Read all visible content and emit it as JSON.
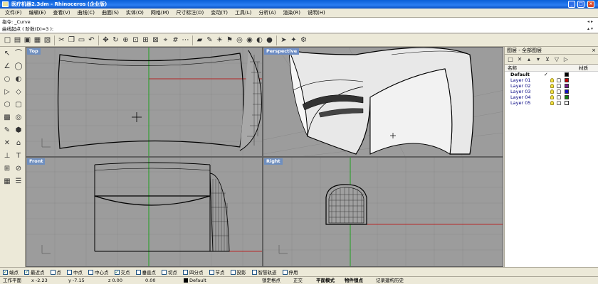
{
  "window": {
    "title": "医疗机器2.3dm - Rhinoceros (企业版)",
    "btn_min": "_",
    "btn_max": "□",
    "btn_close": "×"
  },
  "menu": [
    "文件(F)",
    "编辑(E)",
    "查看(V)",
    "曲线(C)",
    "曲面(S)",
    "实体(O)",
    "网格(M)",
    "尺寸标注(D)",
    "变动(T)",
    "工具(L)",
    "分析(A)",
    "渲染(R)",
    "说明(H)"
  ],
  "command": {
    "line1": "指令: _Curve",
    "line2": "曲线起点 ( 阶数(D)=3 ):",
    "scroll_up": "◂ ▸",
    "scroll_down": "▴ ▾"
  },
  "toolbar_icons": [
    "new-file-icon",
    "open-icon",
    "save-icon",
    "print-icon",
    "import-icon",
    "cut-icon",
    "copy-icon",
    "paste-icon",
    "undo-icon",
    "pan-hand-icon",
    "rotate-view-icon",
    "zoom-icon",
    "zoom-window-icon",
    "zoom-extents-icon",
    "zoom-selected-icon",
    "set-cplane-icon",
    "grid-icon",
    "select-point-icon",
    "layer-icon",
    "properties-icon",
    "lightbulb-icon",
    "bookmark-icon",
    "render-icon",
    "color-icon",
    "material-icon",
    "sphere-render-icon",
    "arrow-icon",
    "puzzle-icon",
    "options-icon"
  ],
  "toolbar_glyphs": [
    "□",
    "▤",
    "▣",
    "▦",
    "▧",
    "✂",
    "❐",
    "▭",
    "↶",
    "✥",
    "↻",
    "⊕",
    "⊡",
    "⊞",
    "⊠",
    "⌖",
    "#",
    "⋯",
    "▰",
    "✎",
    "☀",
    "⚑",
    "◎",
    "◉",
    "◐",
    "●",
    "➤",
    "✦",
    "⚙"
  ],
  "left_tools": [
    "↖",
    "⌒",
    "∠",
    "◯",
    "○",
    "◐",
    "▷",
    "◇",
    "⬡",
    "▢",
    "▩",
    "◎",
    "✎",
    "⬢",
    "✕",
    "⌂",
    "⊥",
    "T",
    "⊞",
    "⊘",
    "▦",
    "☰"
  ],
  "viewports": {
    "top": "Top",
    "perspective": "Perspective",
    "front": "Front",
    "right": "Right"
  },
  "layers_panel": {
    "title": "图层 - 全部图层",
    "close": "×",
    "tools": [
      "□",
      "✕",
      "▴",
      "▾",
      "⊻",
      "▽",
      "▷"
    ],
    "col_name": "名称",
    "col_material": "材质",
    "check": "✓",
    "rows": [
      {
        "name": "Default",
        "color": "#000000",
        "current": true
      },
      {
        "name": "Layer 01",
        "color": "#c00000",
        "current": false
      },
      {
        "name": "Layer 02",
        "color": "#7a1f8a",
        "current": false
      },
      {
        "name": "Layer 03",
        "color": "#1010c0",
        "current": false
      },
      {
        "name": "Layer 04",
        "color": "#108010",
        "current": false
      },
      {
        "name": "Layer 05",
        "color": "#ffffff",
        "current": false
      }
    ]
  },
  "osnaps": [
    {
      "label": "端点",
      "checked": true
    },
    {
      "label": "最近点",
      "checked": true
    },
    {
      "label": "点",
      "checked": false
    },
    {
      "label": "中点",
      "checked": false
    },
    {
      "label": "中心点",
      "checked": false
    },
    {
      "label": "交点",
      "checked": true
    },
    {
      "label": "垂直点",
      "checked": false
    },
    {
      "label": "切点",
      "checked": false
    },
    {
      "label": "四分点",
      "checked": false
    },
    {
      "label": "节点",
      "checked": false
    },
    {
      "label": "投影",
      "checked": false
    },
    {
      "label": "智慧轨迹",
      "checked": false
    },
    {
      "label": "停用",
      "checked": false
    }
  ],
  "status": {
    "cplane": "工作平面",
    "x": "x -2.23",
    "y": "y -7.15",
    "z": "z 0.00",
    "dist": "0.00",
    "layer": "Default",
    "grid_snap": "锁定格点",
    "ortho": "正交",
    "planar": "平面模式",
    "osnap": "物件锁点",
    "history": "记录建构历史"
  },
  "colors": {
    "viewport_bg": "#9c9c9c",
    "grid_line": "#8a8a8a",
    "x_axis": "#c00000",
    "y_axis": "#00a000",
    "label_bg": "#6f8fbf"
  }
}
